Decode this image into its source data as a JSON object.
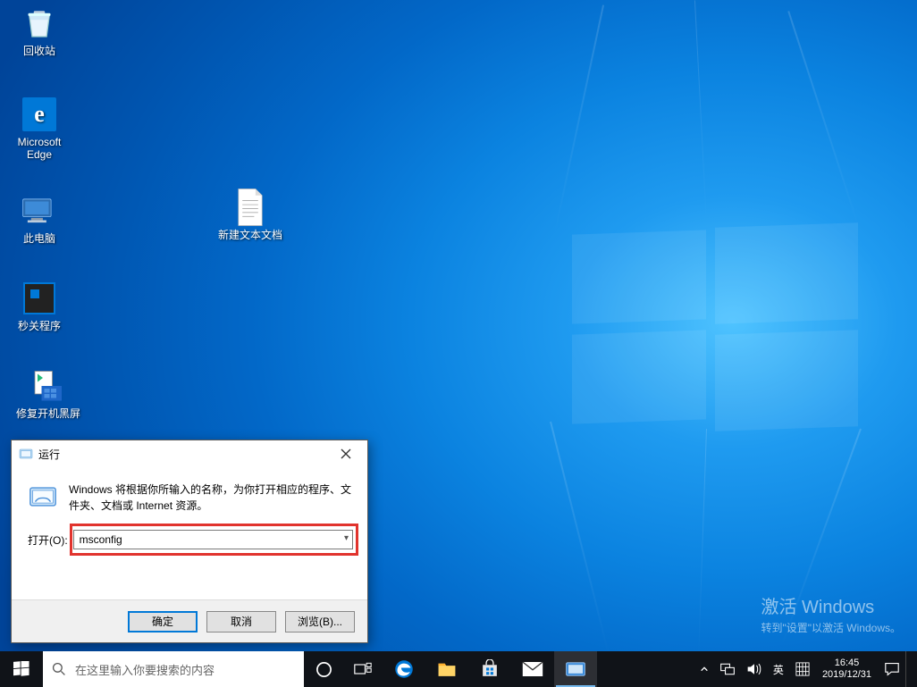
{
  "desktop_icons": {
    "recycle_bin": "回收站",
    "edge": "Microsoft Edge",
    "this_pc": "此电脑",
    "shutdown_app": "秒关程序",
    "fix_blackscreen": "修复开机黑屏",
    "new_text_doc": "新建文本文档"
  },
  "watermark": {
    "title": "激活 Windows",
    "subtitle": "转到\"设置\"以激活 Windows。"
  },
  "run_dialog": {
    "title": "运行",
    "message": "Windows 将根据你所输入的名称，为你打开相应的程序、文件夹、文档或 Internet 资源。",
    "open_label": "打开(O):",
    "input_value": "msconfig",
    "ok": "确定",
    "cancel": "取消",
    "browse": "浏览(B)..."
  },
  "taskbar": {
    "search_placeholder": "在这里输入你要搜索的内容",
    "ime": "英",
    "ime2": "⌨",
    "time": "16:45",
    "date": "2019/12/31"
  }
}
